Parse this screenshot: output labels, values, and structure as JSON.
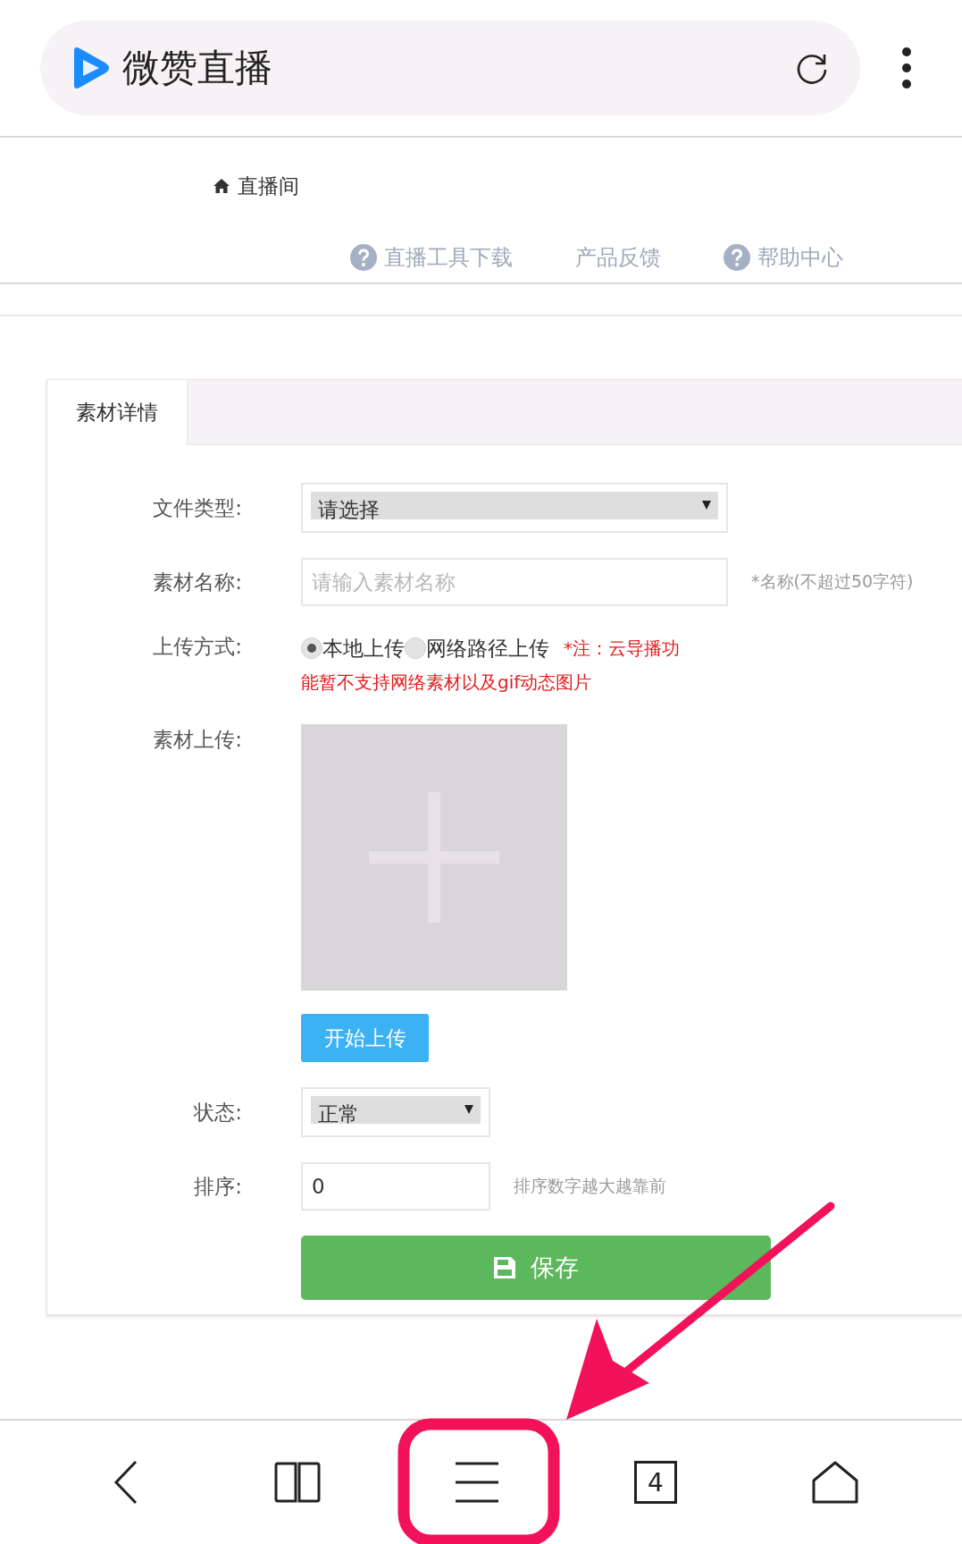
{
  "browser": {
    "title": "微赞直播",
    "tab_count": "4"
  },
  "breadcrumb": "直播间",
  "nav_links": [
    {
      "label": "直播工具下载",
      "kind": "help"
    },
    {
      "label": "产品反馈",
      "kind": "plain"
    },
    {
      "label": "帮助中心",
      "kind": "help"
    }
  ],
  "tabs": [
    {
      "label": "素材详情",
      "selected": true
    }
  ],
  "form": {
    "file_type": {
      "label": "文件类型:",
      "value": "请选择"
    },
    "name": {
      "label": "素材名称:",
      "placeholder": "请输入素材名称",
      "hint": "*名称(不超过50字符)"
    },
    "upload_method": {
      "label": "上传方式:",
      "options": [
        {
          "label": "本地上传",
          "selected": true
        },
        {
          "label": "网络路径上传",
          "selected": false
        }
      ],
      "note_lines": [
        "*注：云导播功",
        "能暂不支持网络素材以及gif动态图片"
      ]
    },
    "upload": {
      "label": "素材上传:",
      "button": "开始上传"
    },
    "status": {
      "label": "状态:",
      "value": "正常"
    },
    "sort": {
      "label": "排序:",
      "value": "0",
      "hint": "排序数字越大越靠前"
    },
    "save": "保存"
  }
}
